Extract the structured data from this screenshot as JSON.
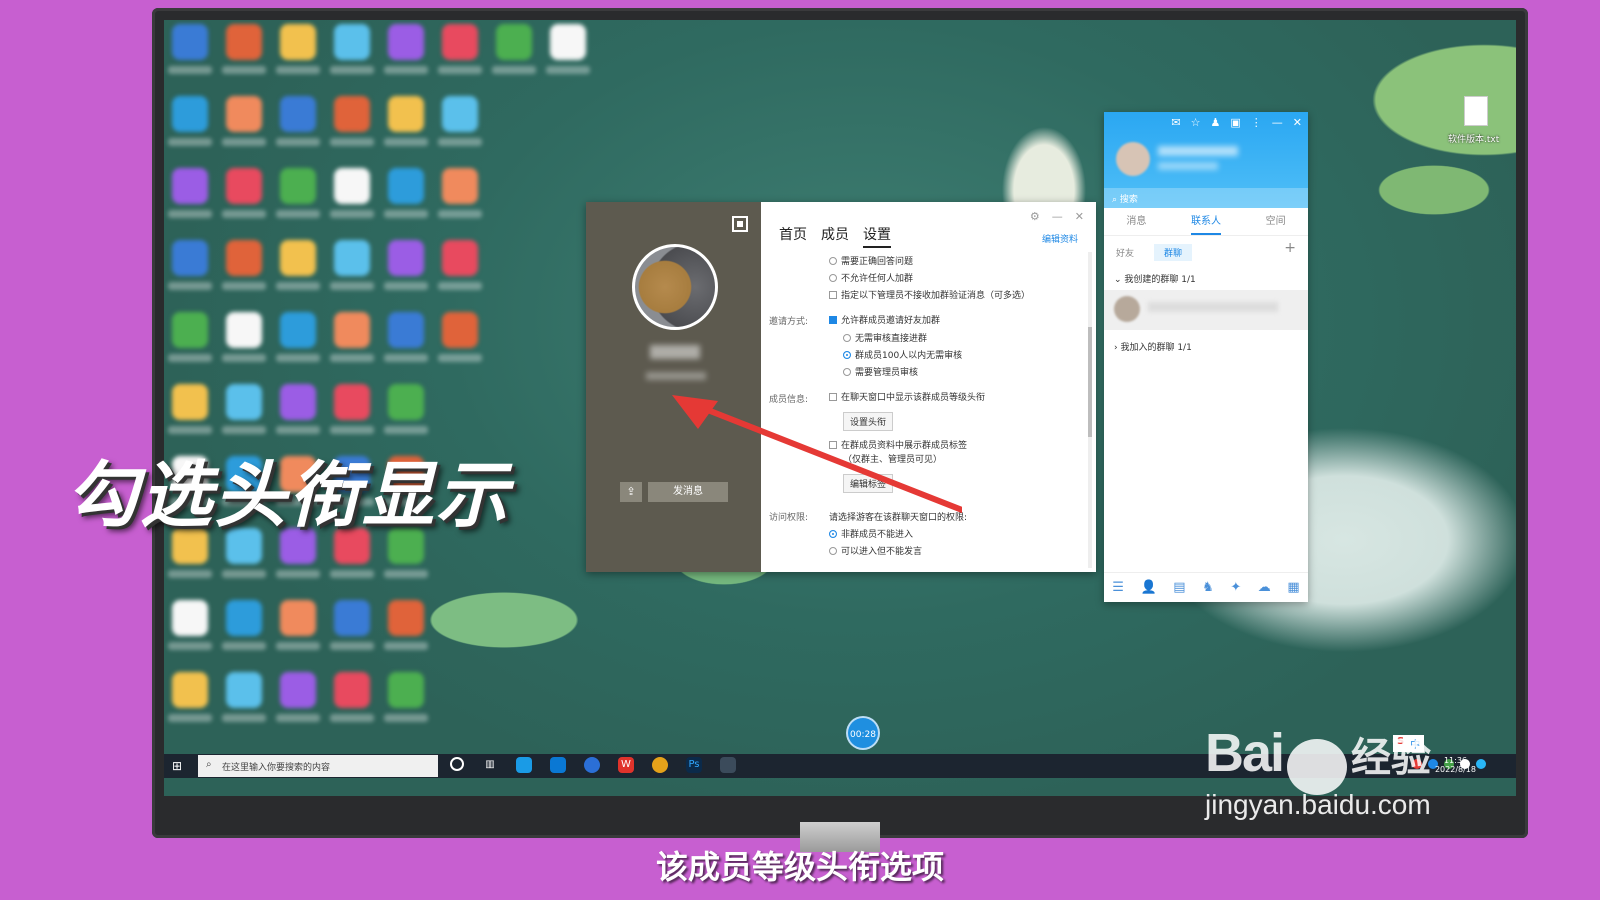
{
  "desktop": {
    "file_label": "软件版本.txt"
  },
  "group_window": {
    "tabs": [
      "首页",
      "成员",
      "设置"
    ],
    "active_tab": "设置",
    "edit_link": "编辑资料",
    "send_button": "发消息",
    "settings": {
      "join_options": [
        "需要正确回答问题",
        "不允许任何人加群",
        "指定以下管理员不接收加群验证消息（可多选）"
      ],
      "invite_label": "邀请方式:",
      "invite_allow": "允许群成员邀请好友加群",
      "invite_options": [
        "无需审核直接进群",
        "群成员100人以内无需审核",
        "需要管理员审核"
      ],
      "member_info_label": "成员信息:",
      "show_title_option": "在聊天窗口中显示该群成员等级头衔",
      "set_title_button": "设置头衔",
      "show_tag_option": "在群成员资料中展示群成员标签",
      "tag_hint": "（仅群主、管理员可见）",
      "edit_tag_button": "编辑标签",
      "access_label": "访问权限:",
      "access_desc": "请选择游客在该群聊天窗口的权限:",
      "access_options": [
        "非群成员不能进入",
        "可以进入但不能发言"
      ]
    }
  },
  "qq_panel": {
    "search_placeholder": "搜索",
    "tabs": [
      "消息",
      "联系人",
      "空间"
    ],
    "active_tab": "联系人",
    "sub_tabs": [
      "好友",
      "群聊"
    ],
    "active_sub": "群聊",
    "created_groups": "我创建的群聊 1/1",
    "joined_groups": "我加入的群聊 1/1"
  },
  "timer": "00:28",
  "taskbar": {
    "search_placeholder": "在这里输入你要搜索的内容",
    "clock_time": "11:36",
    "clock_date": "2022/8/18"
  },
  "ime": [
    "S",
    "中"
  ],
  "captions": {
    "big": "勾选头衔显示",
    "bottom": "该成员等级头衔选项"
  },
  "watermark": {
    "logo": "Bai",
    "logo_end": "经验",
    "url": "jingyan.baidu.com"
  },
  "colors": {
    "accent": "#1e88e5",
    "arrow": "#e53935",
    "background": "#c75fd0"
  }
}
